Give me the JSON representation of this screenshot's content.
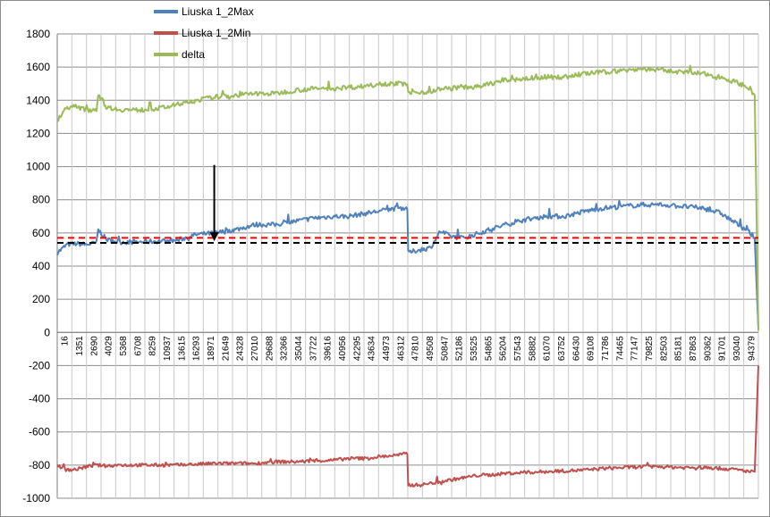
{
  "chart_data": {
    "type": "line",
    "title": "",
    "xlabel": "",
    "ylabel": "",
    "ylim": [
      -1000,
      1800
    ],
    "yticks": [
      1800,
      1600,
      1400,
      1200,
      1000,
      800,
      600,
      400,
      200,
      0,
      -200,
      -400,
      -600,
      -800,
      -1000
    ],
    "xlim": [
      16,
      95500
    ],
    "x_tick_labels": [
      "16",
      "1351",
      "2690",
      "4029",
      "5368",
      "6708",
      "8259",
      "10937",
      "13615",
      "16293",
      "18971",
      "21649",
      "24328",
      "27010",
      "29688",
      "32366",
      "35044",
      "37722",
      "39616",
      "40956",
      "42295",
      "43634",
      "44973",
      "46312",
      "47810",
      "49508",
      "50847",
      "52186",
      "53525",
      "54865",
      "56204",
      "57543",
      "58882",
      "61070",
      "63752",
      "66430",
      "69108",
      "71786",
      "74465",
      "77147",
      "79825",
      "82503",
      "85181",
      "87863",
      "90362",
      "91701",
      "93040",
      "94379"
    ],
    "grid": true,
    "legend_position": "top-left",
    "series": [
      {
        "name": "Liuska 1_2Max",
        "color": "#4f81bd",
        "x": [
          16,
          1351,
          2690,
          4029,
          5368,
          5600,
          6708,
          8259,
          10937,
          13615,
          16293,
          18971,
          21649,
          24328,
          27010,
          29688,
          32366,
          35044,
          37722,
          39616,
          40956,
          42295,
          43634,
          44973,
          46312,
          47700,
          47810,
          49508,
          50847,
          51500,
          52186,
          53525,
          54865,
          56204,
          57543,
          58882,
          61070,
          63752,
          66430,
          69108,
          71786,
          74465,
          77147,
          79825,
          82503,
          85181,
          87863,
          90362,
          91701,
          93040,
          94379,
          95000,
          95500
        ],
        "y": [
          480,
          530,
          535,
          530,
          540,
          620,
          560,
          545,
          545,
          550,
          555,
          590,
          600,
          620,
          650,
          650,
          670,
          690,
          700,
          700,
          710,
          720,
          730,
          740,
          750,
          750,
          480,
          500,
          510,
          560,
          610,
          580,
          570,
          580,
          600,
          620,
          650,
          680,
          700,
          700,
          730,
          750,
          760,
          770,
          770,
          760,
          750,
          720,
          680,
          640,
          600,
          570,
          20
        ]
      },
      {
        "name": "Liuska 1_2Min",
        "color": "#c0504d",
        "x": [
          16,
          1351,
          2690,
          4029,
          5368,
          6708,
          8259,
          10937,
          13615,
          16293,
          18971,
          21649,
          24328,
          27010,
          29688,
          32366,
          35044,
          37722,
          39616,
          40956,
          42295,
          43634,
          44973,
          46312,
          47700,
          47810,
          49508,
          50847,
          52186,
          53525,
          54865,
          56204,
          57543,
          58882,
          61070,
          63752,
          66430,
          69108,
          71786,
          74465,
          77147,
          79825,
          82503,
          85181,
          87863,
          90362,
          91701,
          93040,
          94379,
          95000,
          95500
        ],
        "y": [
          -800,
          -830,
          -825,
          -810,
          -800,
          -805,
          -800,
          -800,
          -800,
          -800,
          -795,
          -790,
          -790,
          -790,
          -780,
          -780,
          -775,
          -770,
          -760,
          -760,
          -760,
          -750,
          -745,
          -740,
          -730,
          -920,
          -920,
          -910,
          -900,
          -890,
          -880,
          -870,
          -860,
          -860,
          -850,
          -845,
          -840,
          -835,
          -830,
          -820,
          -815,
          -810,
          -810,
          -815,
          -815,
          -820,
          -825,
          -830,
          -840,
          -840,
          -200
        ]
      },
      {
        "name": "delta",
        "color": "#9bbb59",
        "x": [
          16,
          1351,
          2690,
          4029,
          5368,
          5600,
          6708,
          8259,
          10937,
          13615,
          16293,
          18971,
          21649,
          24328,
          27010,
          29688,
          32366,
          35044,
          37722,
          39616,
          40956,
          42295,
          43634,
          44973,
          46312,
          47700,
          47810,
          49508,
          50847,
          52186,
          53525,
          54865,
          56204,
          57543,
          58882,
          61070,
          63752,
          66430,
          69108,
          71786,
          74465,
          77147,
          79825,
          82503,
          85181,
          87863,
          90362,
          91701,
          93040,
          94379,
          95000,
          95500
        ],
        "y": [
          1280,
          1360,
          1360,
          1340,
          1345,
          1440,
          1360,
          1345,
          1340,
          1350,
          1370,
          1400,
          1420,
          1430,
          1440,
          1440,
          1460,
          1470,
          1470,
          1480,
          1480,
          1490,
          1500,
          1500,
          1500,
          1500,
          1440,
          1450,
          1450,
          1470,
          1470,
          1480,
          1480,
          1480,
          1500,
          1520,
          1530,
          1540,
          1540,
          1560,
          1570,
          1580,
          1590,
          1580,
          1570,
          1560,
          1540,
          1520,
          1500,
          1470,
          1430,
          10
        ]
      }
    ],
    "reference_lines": [
      {
        "y": 570,
        "color": "#ff0000",
        "style": "dashed"
      },
      {
        "y": 540,
        "color": "#000000",
        "style": "dashed"
      }
    ],
    "annotations": [
      {
        "type": "arrow",
        "color": "#000000",
        "x": 21400,
        "y_from": 1010,
        "y_to": 550
      }
    ]
  }
}
